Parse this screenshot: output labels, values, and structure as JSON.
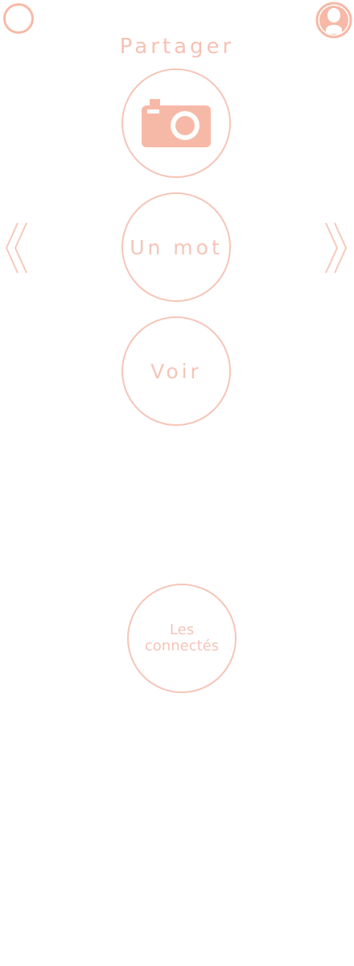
{
  "header": {
    "title": "Partager"
  },
  "actions": {
    "photo_icon": "camera-icon",
    "mot_label": "Un mot",
    "voir_label": "Voir",
    "connected_label": "Les connectés"
  },
  "navigation": {
    "left_icon": "chevron-left-icon",
    "right_icon": "chevron-right-icon"
  },
  "colors": {
    "accent": "#F7B9A7",
    "text": "#F5C5B8"
  }
}
